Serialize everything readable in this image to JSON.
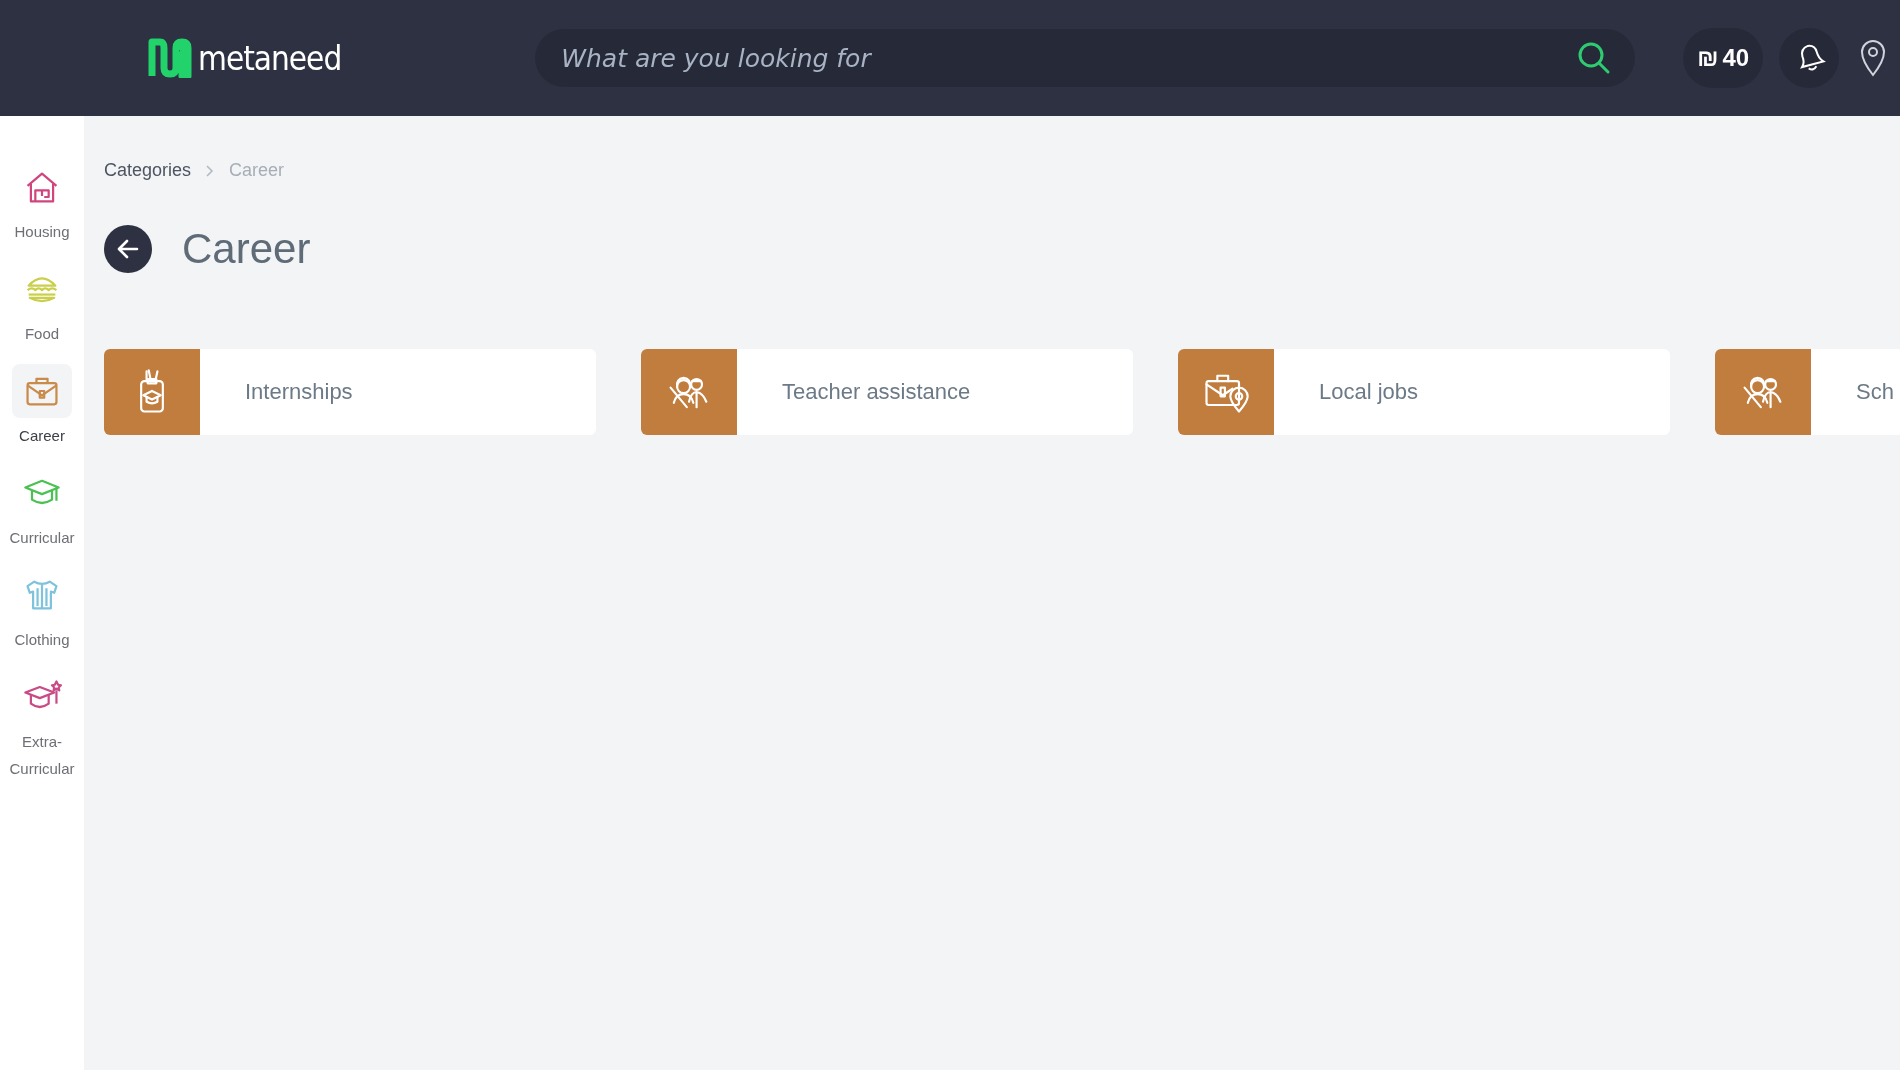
{
  "header": {
    "logo": "metaneed",
    "search": {
      "placeholder": "What are you looking for"
    },
    "coins": {
      "symbol": "₪",
      "amount": "40"
    }
  },
  "sidebar": {
    "items": [
      {
        "label": "Housing",
        "kind": "house",
        "color": "#d1457f",
        "selected": false
      },
      {
        "label": "Food",
        "kind": "burger",
        "color": "#c9cf4a",
        "selected": false
      },
      {
        "label": "Career",
        "kind": "briefcase",
        "color": "#c98a4a",
        "selected": true
      },
      {
        "label": "Curricular",
        "kind": "cap",
        "color": "#4cc153",
        "selected": false
      },
      {
        "label": "Clothing",
        "kind": "shirt",
        "color": "#7ec2dc",
        "selected": false
      },
      {
        "label": "Extra-Curricular",
        "kind": "capstar",
        "color": "#c94a86",
        "selected": false
      }
    ]
  },
  "breadcrumb": [
    {
      "label": "Categories",
      "current": false
    },
    {
      "label": "Career",
      "current": true
    }
  ],
  "title": "Career",
  "cards": [
    {
      "label": "Internships",
      "kind": "badge"
    },
    {
      "label": "Teacher assistance",
      "kind": "people"
    },
    {
      "label": "Local jobs",
      "kind": "briefcase-pin"
    },
    {
      "label": "Sch",
      "kind": "people"
    }
  ]
}
